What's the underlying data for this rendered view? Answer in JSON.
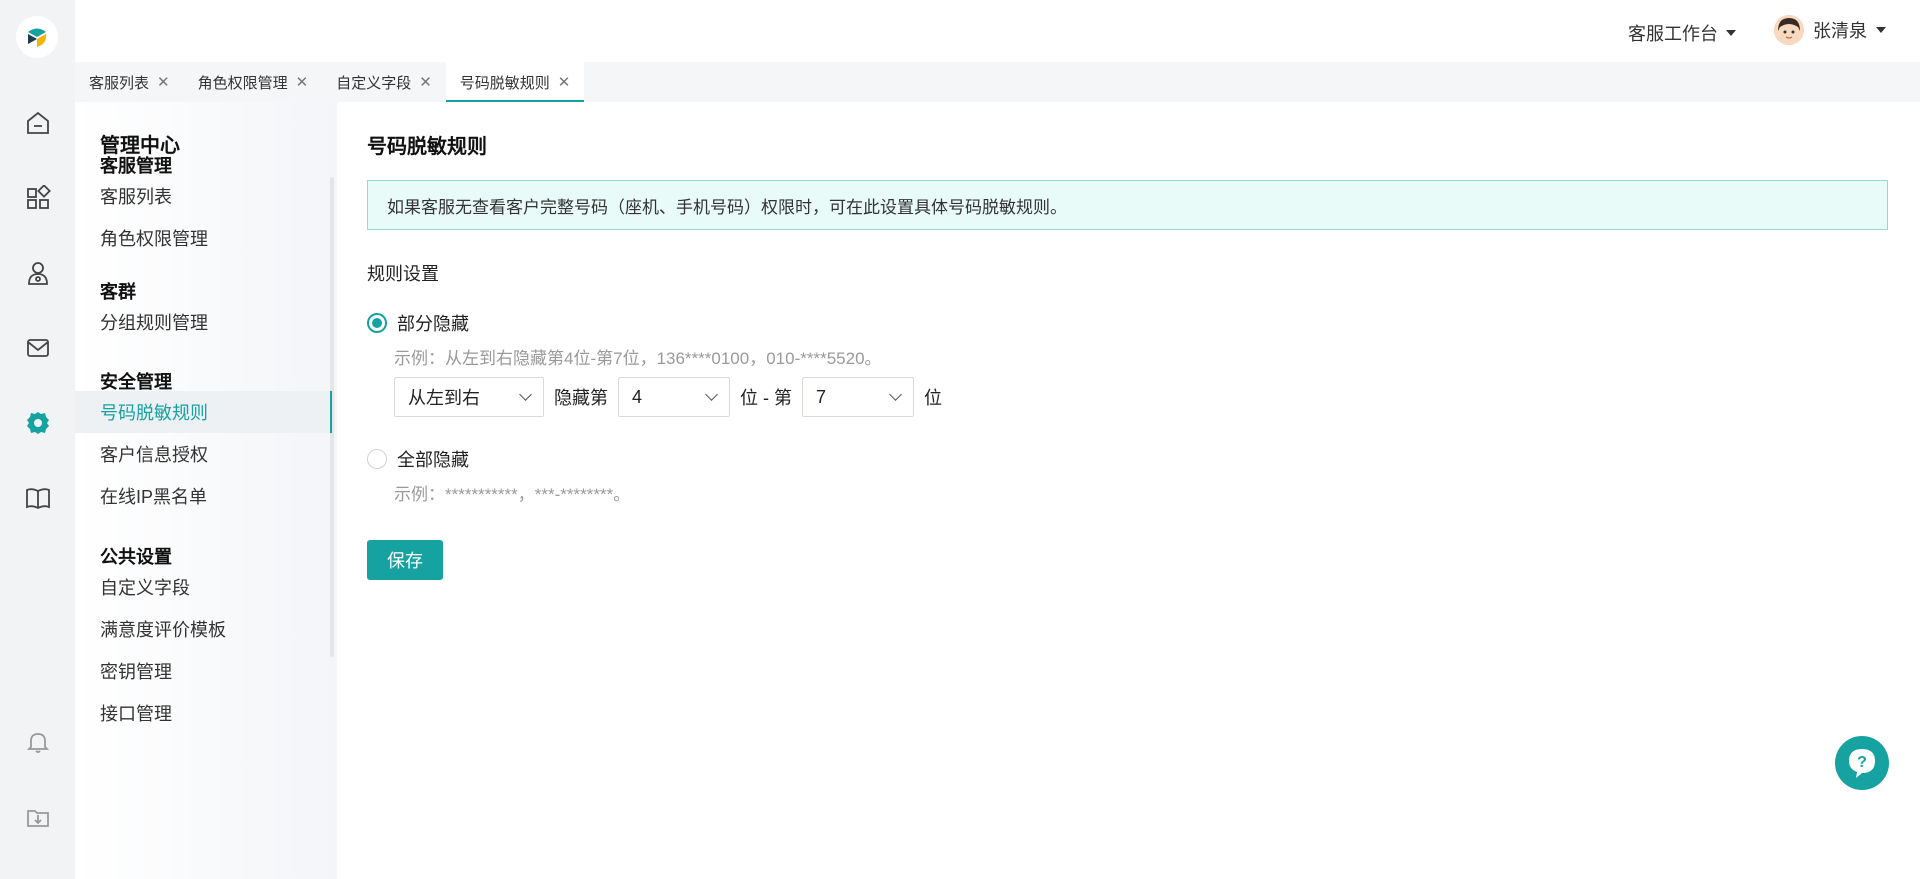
{
  "header": {
    "workbench_label": "客服工作台",
    "user_name": "张清泉"
  },
  "rail": {
    "icons": [
      "home-icon",
      "apps-icon",
      "contacts-icon",
      "mail-icon",
      "settings-icon",
      "book-icon",
      "bell-icon",
      "download-icon"
    ],
    "active": "settings-icon",
    "accent": "#17a2a2"
  },
  "tabs": [
    {
      "label": "客服列表"
    },
    {
      "label": "角色权限管理"
    },
    {
      "label": "自定义字段"
    },
    {
      "label": "号码脱敏规则",
      "active": true
    }
  ],
  "sidemenu": {
    "title": "管理中心",
    "groups": [
      {
        "label": "客服管理",
        "items": [
          "客服列表",
          "角色权限管理"
        ]
      },
      {
        "label": "客群",
        "items": [
          "分组规则管理"
        ]
      },
      {
        "label": "安全管理",
        "items": [
          "号码脱敏规则",
          "客户信息授权",
          "在线IP黑名单"
        ]
      },
      {
        "label": "公共设置",
        "items": [
          "自定义字段",
          "满意度评价模板",
          "密钥管理",
          "接口管理"
        ]
      }
    ],
    "active_item": "号码脱敏规则"
  },
  "main": {
    "title": "号码脱敏规则",
    "notice": "如果客服无查看客户完整号码（座机、手机号码）权限时，可在此设置具体号码脱敏规则。",
    "section_label": "规则设置",
    "option_partial": {
      "label": "部分隐藏",
      "selected": true,
      "example": "示例：从左到右隐藏第4位-第7位，136****0100，010-****5520。",
      "direction_select": "从左到右",
      "text_hide_from": "隐藏第",
      "start_select": "4",
      "text_to": "位 - 第",
      "end_select": "7",
      "text_unit": "位"
    },
    "option_full": {
      "label": "全部隐藏",
      "selected": false,
      "example": "示例：***********，***-********。"
    },
    "save_label": "保存"
  },
  "help_fab": {
    "label": "?"
  }
}
